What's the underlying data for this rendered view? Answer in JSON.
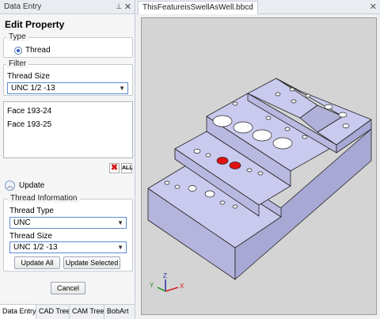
{
  "panel": {
    "title": "Data Entry",
    "pin_icon": "pin-icon",
    "close_icon": "close-icon",
    "heading": "Edit Property",
    "type_group": {
      "legend": "Type",
      "radio_label": "Thread"
    },
    "filter_group": {
      "legend": "Filter",
      "size_label": "Thread Size",
      "size_value": "UNC 1/2 -13"
    },
    "faces": [
      "Face 193-24",
      "Face 193-25"
    ],
    "delete_icon": "delete-icon",
    "all_icon_label": "ALL",
    "update_label": "Update",
    "info_group": {
      "legend": "Thread Information",
      "type_label": "Thread Type",
      "type_value": "UNC",
      "size_label": "Thread Size",
      "size_value": "UNC 1/2 -13"
    },
    "update_all": "Update All",
    "update_selected": "Update Selected",
    "cancel": "Cancel",
    "tabs": [
      "Data Entry",
      "CAD Tree",
      "CAM Tree",
      "BobArt"
    ]
  },
  "document": {
    "tab": "ThisFeatureisSwellAsWell.bbcd",
    "close_icon": "close-icon"
  },
  "colors": {
    "model_fill": "#c8c8ec",
    "model_edge": "#222222",
    "highlight": "#e21010",
    "viewport_bg": "#d4d4d4"
  }
}
